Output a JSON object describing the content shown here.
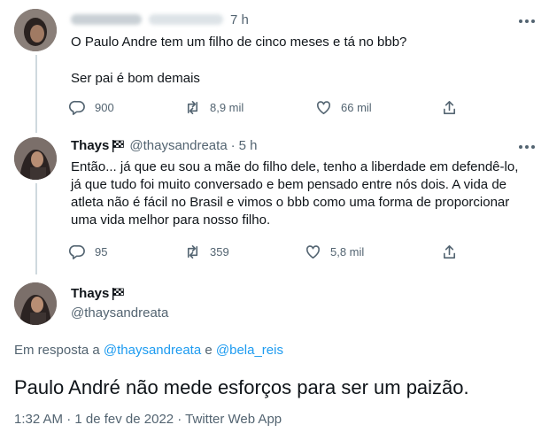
{
  "tweet1": {
    "time": "7 h",
    "text_line1": "O Paulo Andre tem um filho de cinco meses e tá no bbb?",
    "text_line2": "Ser pai é bom demais",
    "reply_count": "900",
    "retweet_count": "8,9 mil",
    "like_count": "66 mil"
  },
  "tweet2": {
    "name": "Thays",
    "handle": "@thaysandreata",
    "sep": "·",
    "time": "5 h",
    "lines": [
      "Então... já que eu sou a mãe do filho dele, tenho a liberdade em defendê-lo,",
      "já que tudo foi muito conversado e bem pensado entre nós dois. A vida de",
      "atleta não é fácil no Brasil e vimos o bbb como uma forma de proporcionar",
      "uma vida melhor para nosso filho."
    ],
    "reply_count": "95",
    "retweet_count": "359",
    "like_count": "5,8 mil"
  },
  "tweet3": {
    "name": "Thays",
    "handle": "@thaysandreata",
    "reply_prefix": "Em resposta a",
    "reply_user1": "@thaysandreata",
    "reply_and": "e",
    "reply_user2": "@bela_reis",
    "text": "Paulo André não mede esforços para ser um paizão.",
    "meta": "1:32 AM · 1 de fev de 2022 · Twitter Web App"
  },
  "colors": {
    "link": "#1d9bf0",
    "muted": "#536471",
    "text": "#0f1419",
    "thread_line": "#cfd9de"
  },
  "icons": [
    "reply-icon",
    "retweet-icon",
    "like-icon",
    "share-icon",
    "more-options-icon",
    "checkered-flag-icon"
  ]
}
